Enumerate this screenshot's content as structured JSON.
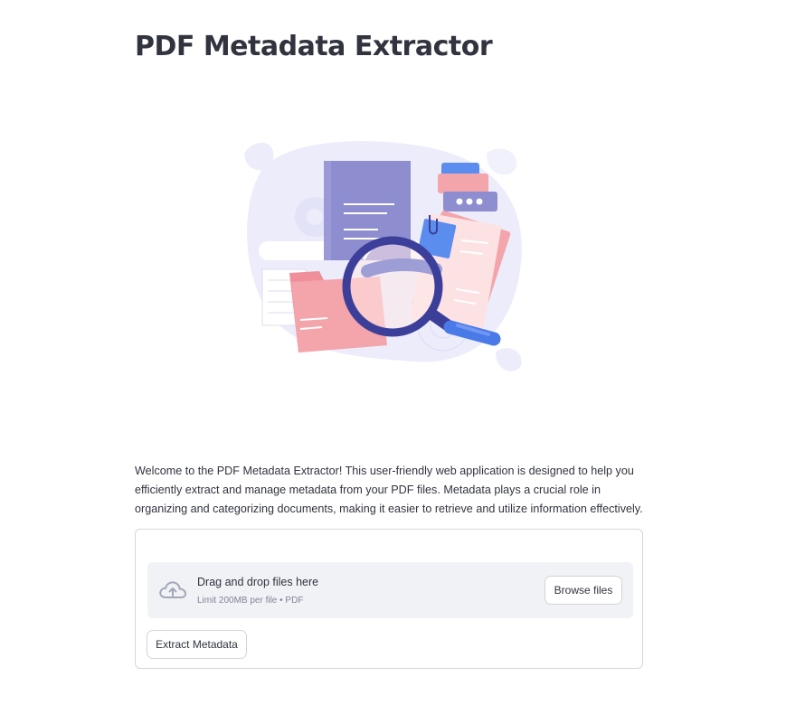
{
  "header": {
    "title": "PDF Metadata Extractor"
  },
  "hero": {
    "icon": "document-search-illustration"
  },
  "intro": {
    "text": "Welcome to the PDF Metadata Extractor! This user-friendly web application is designed to help you efficiently extract and manage metadata from your PDF files. Metadata plays a crucial role in organizing and categorizing documents, making it easier to retrieve and utilize information effectively."
  },
  "uploader": {
    "drop_label": "Drag and drop files here",
    "limit_text": "Limit 200MB per file • PDF",
    "browse_label": "Browse files",
    "icon": "cloud-upload-icon"
  },
  "actions": {
    "extract_label": "Extract Metadata"
  },
  "colors": {
    "text": "#31333f",
    "muted": "#808495",
    "dropzone_bg": "#f0f2f6",
    "border": "#d6d6d9",
    "accent_navy": "#3c3f9a",
    "accent_pink": "#f4a4ab",
    "accent_lavender": "#8e8fce"
  }
}
